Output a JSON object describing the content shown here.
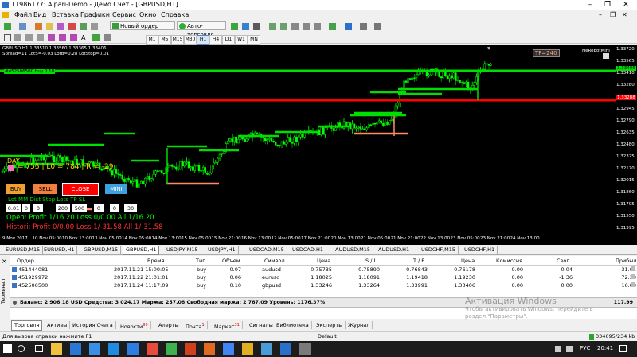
{
  "window": {
    "title": "11986177: Alpari-Demo - Демо Счет - [GBPUSD,H1]",
    "controls": [
      "–",
      "❐",
      "✕"
    ]
  },
  "menu": {
    "items": [
      "Файл",
      "Вид",
      "Вставка",
      "Графики",
      "Сервис",
      "Окно",
      "Справка"
    ],
    "right_controls": [
      "–",
      "❐",
      "✕"
    ]
  },
  "toolbar": {
    "new_order_label": "Новый ордер",
    "auto_trading_label": "Авто-торговля",
    "timeframes": [
      "M1",
      "M5",
      "M15",
      "M30",
      "H1",
      "H4",
      "D1",
      "W1",
      "MN"
    ],
    "active_timeframe": "H1"
  },
  "chart": {
    "header_line1": "GBPUSD,H1  1.33510 1.33560 1.33365 1.33406",
    "header_line2": "Spread=11  LotS=-0.03  LotB=0.28  LotStop=0.01",
    "order_label": "#452506500  buy 0.10",
    "tf_badge": "TF=240",
    "robot_name": "HeRobotMini",
    "panel": {
      "day_label": "DAY",
      "stats_line": "= 755 | L0 = 784 | R = -29",
      "buy_label": "BUY",
      "sell_label": "SELL",
      "close_label": "CLOSE",
      "mini_label": "MINI",
      "params_header": "Lot    MM   Dist   Stop   Lots   TP    SL",
      "inputs": [
        "0.01",
        "0",
        "0",
        "200",
        "500",
        "0",
        "0",
        "30"
      ],
      "open_line": "Open:  Profit 1/16.20  Loss 0/0.00   All 1/16.20",
      "history_line": "Histori: Profit 0/0.00  Loss 1/-31.58  All 1/-31.58"
    },
    "y_labels": [
      "1.33720",
      "1.33565",
      "1.33410",
      "1.33280",
      "1.33100",
      "1.32945",
      "1.32790",
      "1.32635",
      "1.32480",
      "1.32325",
      "1.32170",
      "1.32015",
      "1.31860",
      "1.31705",
      "1.31550",
      "1.31395"
    ],
    "price_tags": [
      "1.33406",
      "1.33288"
    ],
    "x_labels": [
      "9 Nov 2017",
      "10 Nov 05:00",
      "10 Nov 13:00",
      "13 Nov 05:00",
      "14 Nov 05:00",
      "14 Nov 13:00",
      "15 Nov 05:00",
      "15 Nov 21:00",
      "16 Nov 13:00",
      "17 Nov 05:00",
      "17 Nov 21:00",
      "20 Nov 13:00",
      "21 Nov 05:00",
      "21 Nov 21:00",
      "22 Nov 13:00",
      "23 Nov 05:00",
      "23 Nov 21:00",
      "24 Nov 13:00"
    ]
  },
  "chart_tabs": {
    "items": [
      "EURUSD,M15",
      "EURUSD,H1",
      "GBPUSD,M15",
      "GBPUSD,H1",
      "USDJPY,M15",
      "USDJPY,H1",
      "USDCAD,M15",
      "USDCAD,H1",
      "AUDUSD,M15",
      "AUDUSD,H1",
      "USDCHF,M15",
      "USDCHF,H1"
    ],
    "active": "GBPUSD,H1"
  },
  "terminal": {
    "side_label": "Терминал",
    "close_x": "×",
    "columns": [
      "Ордер",
      "Время",
      "Тип",
      "Объем",
      "Символ",
      "Цена",
      "S / L",
      "T / P",
      "Цена",
      "Комиссия",
      "Своп",
      "Прибыль"
    ],
    "rows": [
      [
        "451444081",
        "2017.11.21 15:00:05",
        "buy",
        "0.07",
        "audusd",
        "0.75735",
        "0.75890",
        "0.76843",
        "0.76178",
        "0.00",
        "0.04",
        "31.01"
      ],
      [
        "451929972",
        "2017.11.22 21:01:01",
        "buy",
        "0.06",
        "eurusd",
        "1.18025",
        "1.18091",
        "1.19418",
        "1.19230",
        "0.00",
        "-1.36",
        "72.30"
      ],
      [
        "452506500",
        "2017.11.24 11:17:09",
        "buy",
        "0.10",
        "gbpusd",
        "1.33246",
        "1.33264",
        "1.33991",
        "1.33406",
        "0.00",
        "0.00",
        "16.00"
      ]
    ],
    "balance_line": "Баланс: 2 906.18 USD  Средства: 3 024.17  Маржа: 257.08  Свободная маржа: 2 767.09  Уровень: 1176.37%",
    "balance_total": "117.99",
    "tabs": [
      {
        "label": "Торговля",
        "badge": ""
      },
      {
        "label": "Активы",
        "badge": ""
      },
      {
        "label": "История Счета",
        "badge": ""
      },
      {
        "label": "Новости",
        "badge": "99"
      },
      {
        "label": "Алерты",
        "badge": ""
      },
      {
        "label": "Почта",
        "badge": "1"
      },
      {
        "label": "Маркет",
        "badge": "31"
      },
      {
        "label": "Сигналы",
        "badge": ""
      },
      {
        "label": "Библиотека",
        "badge": ""
      },
      {
        "label": "Эксперты",
        "badge": ""
      },
      {
        "label": "Журнал",
        "badge": ""
      }
    ]
  },
  "watermark": {
    "line1": "Активация Windows",
    "line2": "Чтобы активировать Windows, перейдите в",
    "line3": "раздел \"Параметры\"."
  },
  "statusbar": {
    "help": "Для вызова справки нажмите F1",
    "profile": "Default",
    "traffic": "334695/234 kb"
  },
  "taskbar": {
    "lang": "РУС",
    "time": "20:41"
  },
  "colors": {
    "chart_bg": "#000000",
    "bull_candle": "#00ff00",
    "bear_candle": "#00a000",
    "green_line": "#00dd00",
    "red_line": "#ff0000",
    "salmon_line": "#ff8a65"
  }
}
